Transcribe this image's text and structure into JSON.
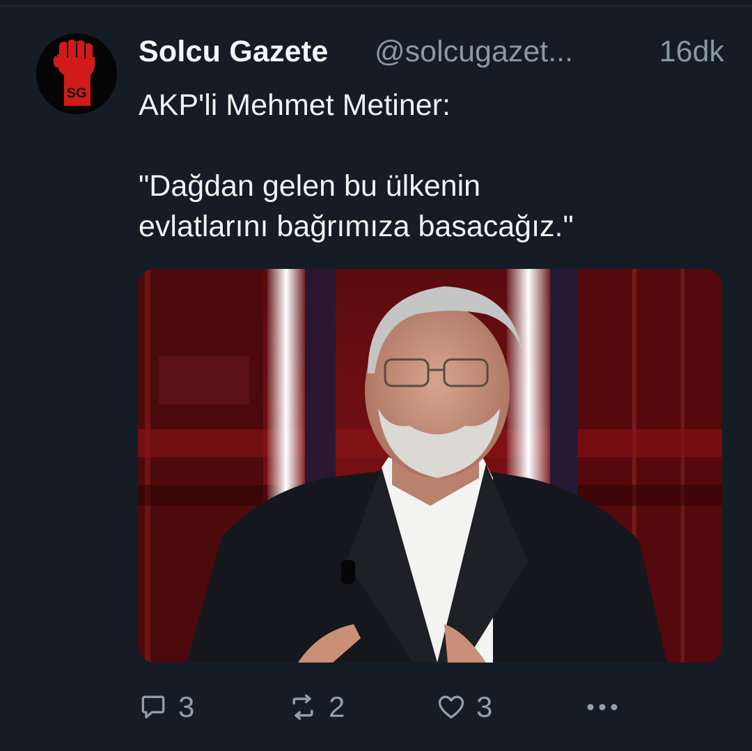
{
  "tweet": {
    "author_name": "Solcu Gazete",
    "author_handle": "@solcugazet...",
    "time": "16dk",
    "avatar_text": "SG",
    "text_lines": [
      "AKP'li Mehmet Metiner:",
      "",
      "\"Dağdan gelen bu ülkenin",
      "evlatlarını bağrımıza basacağız.\""
    ],
    "media": {
      "alt": "photo of man in dark suit in TV studio"
    }
  },
  "actions": {
    "reply_count": "3",
    "retweet_count": "2",
    "like_count": "3"
  },
  "icons": [
    "reply-icon",
    "retweet-icon",
    "like-icon",
    "more-icon"
  ],
  "colors": {
    "background": "#161c25",
    "muted": "#8899a6",
    "avatar_fist": "#d11a1a"
  }
}
